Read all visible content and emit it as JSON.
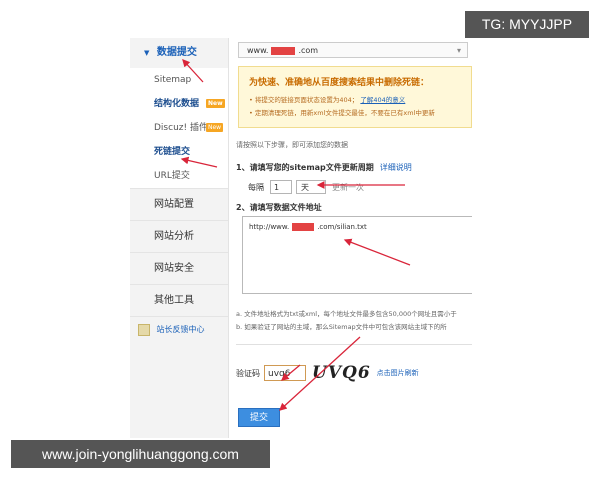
{
  "sidebar": {
    "header": "数据提交",
    "sub_items": [
      {
        "label": "Sitemap",
        "bold": false,
        "badge": ""
      },
      {
        "label": "结构化数据",
        "bold": true,
        "badge": "New"
      },
      {
        "label": "Discuz! 插件",
        "bold": false,
        "badge": "New"
      },
      {
        "label": "死链提交",
        "bold": true,
        "badge": ""
      },
      {
        "label": "URL提交",
        "bold": false,
        "badge": ""
      }
    ],
    "sections": [
      "网站配置",
      "网站分析",
      "网站安全",
      "其他工具"
    ],
    "feedback": "站长反馈中心"
  },
  "site_select": {
    "prefix": "www.",
    "suffix": ".com"
  },
  "notice": {
    "title": "为快速、准确地从百度搜索结果中删除死链：",
    "line1": "• 将提交的链接页面状态设置为404；",
    "line1_link": "了解404的意义",
    "line2": "• 定期清理死链，用新xml文件提交最佳，不要在已有xml中更新"
  },
  "hint": "请按照以下步骤，即可添加您的数据",
  "step1": {
    "title": "1、请填写您的sitemap文件更新周期",
    "link": "详细说明"
  },
  "frequency": {
    "prefix": "每隔",
    "number": "1",
    "unit": "天",
    "suffix": "更新一次"
  },
  "step2": {
    "title": "2、请填写数据文件地址"
  },
  "file_url": {
    "prefix": "http://www.",
    "suffix": ".com/silian.txt"
  },
  "tips": {
    "a": "a. 文件地址格式为txt或xml，每个地址文件最多包含50,000个网址且需小于",
    "b": "b. 如果验证了网站的主域，那么Sitemap文件中可包含该网站主域下的所"
  },
  "captcha": {
    "label": "验证码",
    "value": "uvq6",
    "image_text": "UVQ6",
    "refresh": "点击图片刷新"
  },
  "submit_label": "提交",
  "watermarks": {
    "top_right": "TG: MYYJJPP",
    "bottom_left": "www.join-yonglihuanggong.com"
  },
  "colors": {
    "accent": "#1a60b8",
    "annotation_arrow": "#d9253a",
    "notice_bg": "#fff8d9",
    "button": "#3d8ee0"
  }
}
